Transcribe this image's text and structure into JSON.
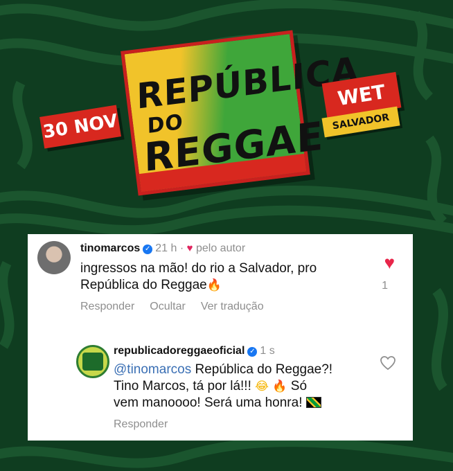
{
  "banner": {
    "title_line1": "REPÚBLICA",
    "title_line2": "DO",
    "title_line3": "REGGAE",
    "date": "30 NOV",
    "venue": "WET",
    "city": "SALVADOR"
  },
  "comment": {
    "username": "tinomarcos",
    "time": "21 h",
    "by_author": "pelo autor",
    "text_line1": "ingressos na mão! do rio a Salvador, pro",
    "text_line2": "República do Reggae",
    "actions": [
      "Responder",
      "Ocultar",
      "Ver tradução"
    ],
    "like_count": "1"
  },
  "reply": {
    "username": "republicadoreggaeoficial",
    "time": "1 s",
    "mention": "@tinomarcos",
    "text_line1": "República do Reggae?!",
    "text_line2": "Tino Marcos, tá por lá!!!",
    "text_line2b": "Só",
    "text_line3": "vem manoooo! Será uma honra!",
    "action": "Responder"
  },
  "colors": {
    "background": "#0f3d20",
    "flag_red": "#d8281f",
    "flag_yellow": "#f1c32a",
    "flag_green": "#3fa63a",
    "verified_blue": "#1877f2",
    "like_red": "#e8264a",
    "mention_blue": "#3a6fb4"
  },
  "icons": [
    "verified-icon",
    "heart-filled-icon",
    "heart-outline-icon",
    "fire-emoji",
    "laughing-emoji",
    "jamaica-flag-emoji"
  ]
}
